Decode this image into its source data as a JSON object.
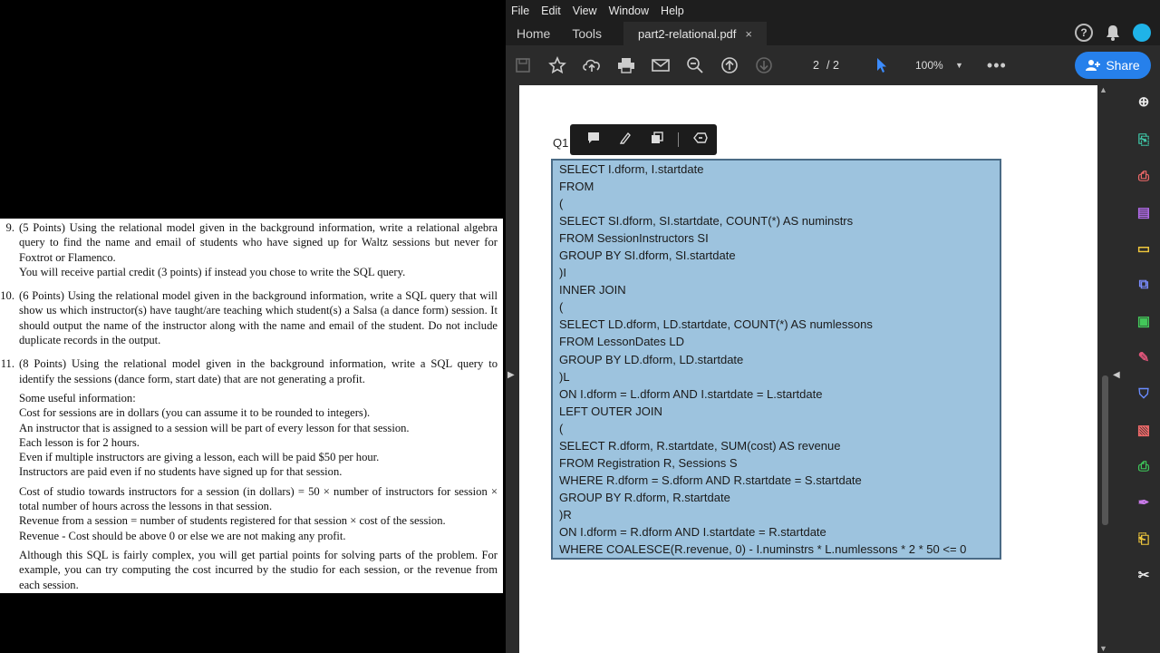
{
  "left_doc": {
    "q9": {
      "num": "9.",
      "p1": "(5 Points) Using the relational model given in the background information, write a relational algebra query to find the name and email of students who have signed up for Waltz sessions but never for Foxtrot or Flamenco.",
      "p2": "You will receive partial credit (3 points) if instead you chose to write the SQL query."
    },
    "q10": {
      "num": "10.",
      "p1": "(6 Points) Using the relational model given in the background information, write a SQL query that will show us which instructor(s) have taught/are teaching which student(s) a Salsa (a dance form) session. It should output the name of the instructor along with the name and email of the student. Do not include duplicate records in the output."
    },
    "q11": {
      "num": "11.",
      "p1": "(8 Points) Using the relational model given in the background information, write a SQL query to identify the sessions (dance form, start date) that are not generating a profit.",
      "info": [
        "Some useful information:",
        "Cost for sessions are in dollars (you can assume it to be rounded to integers).",
        "An instructor that is assigned to a session will be part of every lesson for that session.",
        "Each lesson is for 2 hours.",
        "Even if multiple instructors are giving a lesson, each will be paid $50 per hour.",
        "Instructors are paid even if no students have signed up for that session."
      ],
      "cost": [
        "Cost of studio towards instructors for a session (in dollars) = 50 × number of instructors for session × total number of hours across the lessons in that session.",
        "Revenue from a session = number of students registered for that session × cost of the session.",
        "Revenue - Cost should be above 0 or else we are not making any profit."
      ],
      "closing": "Although this SQL is fairly complex, you will get partial points for solving parts of the problem. For example, you can try computing the cost incurred by the studio for each session, or the revenue from each session."
    }
  },
  "acrobat": {
    "menu": [
      "File",
      "Edit",
      "View",
      "Window",
      "Help"
    ],
    "nav_tabs": [
      "Home",
      "Tools"
    ],
    "doc_tab": "part2-relational.pdf",
    "tab_close": "×",
    "help_glyph": "?",
    "page_current": "2",
    "page_total": "/ 2",
    "zoom": "100%",
    "share_label": "Share",
    "question_label": "Q1",
    "sql_lines": [
      "SELECT I.dform, I.startdate",
      "FROM",
      "(",
      "SELECT SI.dform, SI.startdate, COUNT(*) AS numinstrs",
      "FROM SessionInstructors SI",
      "GROUP BY SI.dform, SI.startdate",
      ")I",
      "INNER JOIN",
      "(",
      "SELECT LD.dform, LD.startdate, COUNT(*) AS numlessons",
      "FROM LessonDates LD",
      "GROUP BY LD.dform, LD.startdate",
      ")L",
      "ON I.dform = L.dform AND I.startdate = L.startdate",
      "LEFT OUTER JOIN",
      "(",
      "SELECT R.dform, R.startdate, SUM(cost) AS revenue",
      "FROM Registration R, Sessions S",
      "WHERE R.dform = S.dform AND R.startdate = S.startdate",
      "GROUP BY R.dform, R.startdate",
      ")R",
      "ON I.dform = R.dform AND I.startdate = R.startdate",
      "WHERE COALESCE(R.revenue, 0) - I.numinstrs * L.numlessons * 2 * 50 <= 0"
    ],
    "colors": {
      "accent": "#2680eb",
      "sql_highlight": "#9dc3de",
      "rail_icons": [
        "#e8e8e8",
        "#3ec8a8",
        "#f06a6a",
        "#b06ae8",
        "#f0c83c",
        "#7a8cff",
        "#43c85a",
        "#e0557a",
        "#6a8cff",
        "#f06a6a",
        "#3ec85a",
        "#c87ae8",
        "#f0c83c",
        "#e8e8e8"
      ]
    }
  }
}
